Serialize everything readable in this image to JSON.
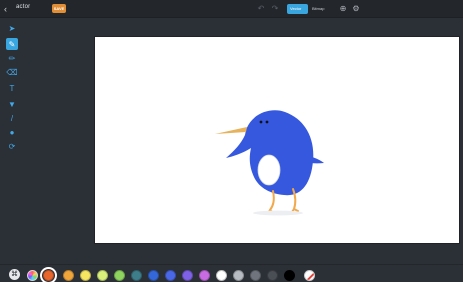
{
  "header": {
    "back_glyph": "‹",
    "title": "actor",
    "pill": "SAVE",
    "undo_glyph": "↶",
    "redo_glyph": "↷",
    "mode_vector": "Vector",
    "mode_bitmap": "Bitmap",
    "icons": [
      "zoom-icon",
      "settings-icon"
    ]
  },
  "tools": [
    {
      "name": "select-tool",
      "glyph": "➤"
    },
    {
      "name": "brush-tool",
      "glyph": "✎"
    },
    {
      "name": "pencil-tool",
      "glyph": "✏"
    },
    {
      "name": "eraser-tool",
      "glyph": "⌫"
    },
    {
      "name": "text-tool",
      "glyph": "T"
    },
    {
      "name": "fill-tool",
      "glyph": "▼"
    },
    {
      "name": "line-tool",
      "glyph": "/"
    },
    {
      "name": "shape-tool",
      "glyph": "●"
    },
    {
      "name": "stamp-tool",
      "glyph": "⟳"
    }
  ],
  "palette": {
    "selected": "#e8672f",
    "colors": [
      "#e8672f",
      "#f0a63b",
      "#f5e561",
      "#d8f07a",
      "#b6e15a",
      "#8ed45f",
      "#3d7e8a",
      "#3467d9",
      "#4a67e8",
      "#7e61e6",
      "#c96ce3",
      "#ffffff",
      "#b7bcc2",
      "#70757d",
      "#4a4e55",
      "#000000"
    ]
  },
  "canvas": {
    "background": "#ffffff",
    "creature": {
      "body_color": "#3558df",
      "belly_color": "#ffffff",
      "beak_color": "#e6b25b",
      "leg_color": "#f1a94b"
    }
  }
}
